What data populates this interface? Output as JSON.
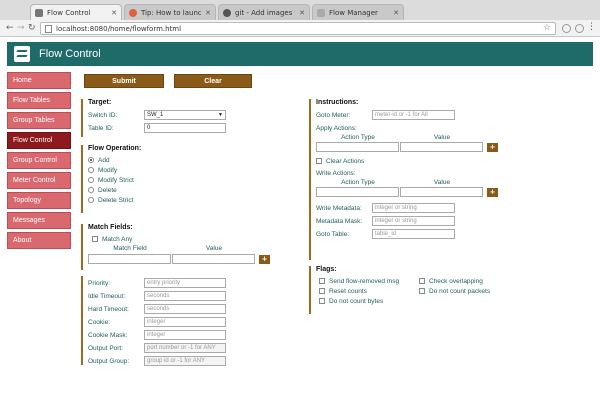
{
  "browser": {
    "tabs": [
      {
        "title": "Flow Control",
        "fav_color": "#777777",
        "active": true
      },
      {
        "title": "Tip: How to launch a",
        "fav_color": "#e0623a",
        "active": false
      },
      {
        "title": "git - Add images to R",
        "fav_color": "#555555",
        "active": false
      },
      {
        "title": "Flow Manager",
        "fav_color": "#aaaaaa",
        "active": false
      }
    ],
    "url": "localhost:8080/home/flowform.html"
  },
  "app": {
    "title": "Flow Control",
    "header_color": "#1f6b6a"
  },
  "sidebar": {
    "items": [
      {
        "label": "Home"
      },
      {
        "label": "Flow Tables"
      },
      {
        "label": "Group Tables"
      },
      {
        "label": "Flow Control",
        "active": true
      },
      {
        "label": "Group Control"
      },
      {
        "label": "Meter Control"
      },
      {
        "label": "Topology"
      },
      {
        "label": "Messages"
      },
      {
        "label": "About"
      }
    ]
  },
  "actions": {
    "submit": "Submit",
    "clear": "Clear"
  },
  "target": {
    "title": "Target:",
    "switch_label": "Switch ID:",
    "switch_value": "SW_1",
    "table_label": "Table ID:",
    "table_value": "0"
  },
  "operation": {
    "title": "Flow Operation:",
    "options": [
      "Add",
      "Modify",
      "Modify Strict",
      "Delete",
      "Delete Strict"
    ],
    "selected": "Add"
  },
  "match": {
    "title": "Match Fields:",
    "match_any": "Match Any",
    "col_field": "Match Field",
    "col_value": "Value",
    "plus": "+"
  },
  "fields": [
    {
      "label": "Priority:",
      "placeholder": "entry priority"
    },
    {
      "label": "Idle Timeout:",
      "placeholder": "seconds"
    },
    {
      "label": "Hard Timeout:",
      "placeholder": "seconds"
    },
    {
      "label": "Cookie:",
      "placeholder": "integer"
    },
    {
      "label": "Cookie Mask:",
      "placeholder": "integer"
    },
    {
      "label": "Output Port:",
      "placeholder": "port number or -1 for ANY"
    },
    {
      "label": "Output Group:",
      "placeholder": "group id or -1 for ANY"
    }
  ],
  "instructions": {
    "title": "Instructions:",
    "goto_meter_label": "Goto Meter:",
    "goto_meter_placeholder": "meter-id or -1 for All",
    "apply_title": "Apply Actions:",
    "col_type": "Action Type",
    "col_value": "Value",
    "plus": "+",
    "clear_actions": "Clear Actions",
    "write_title": "Write Actions:",
    "write_meta_label": "Write Metadata:",
    "write_meta_placeholder": "integer or string",
    "meta_mask_label": "Metadata Mask:",
    "meta_mask_placeholder": "integer or string",
    "goto_table_label": "Goto Table:",
    "goto_table_placeholder": "table_id"
  },
  "flags": {
    "title": "Flags:",
    "items": [
      "Send flow-removed msg",
      "Check overlapping",
      "Reset counts",
      "Do not count packets",
      "Do not count bytes"
    ]
  }
}
